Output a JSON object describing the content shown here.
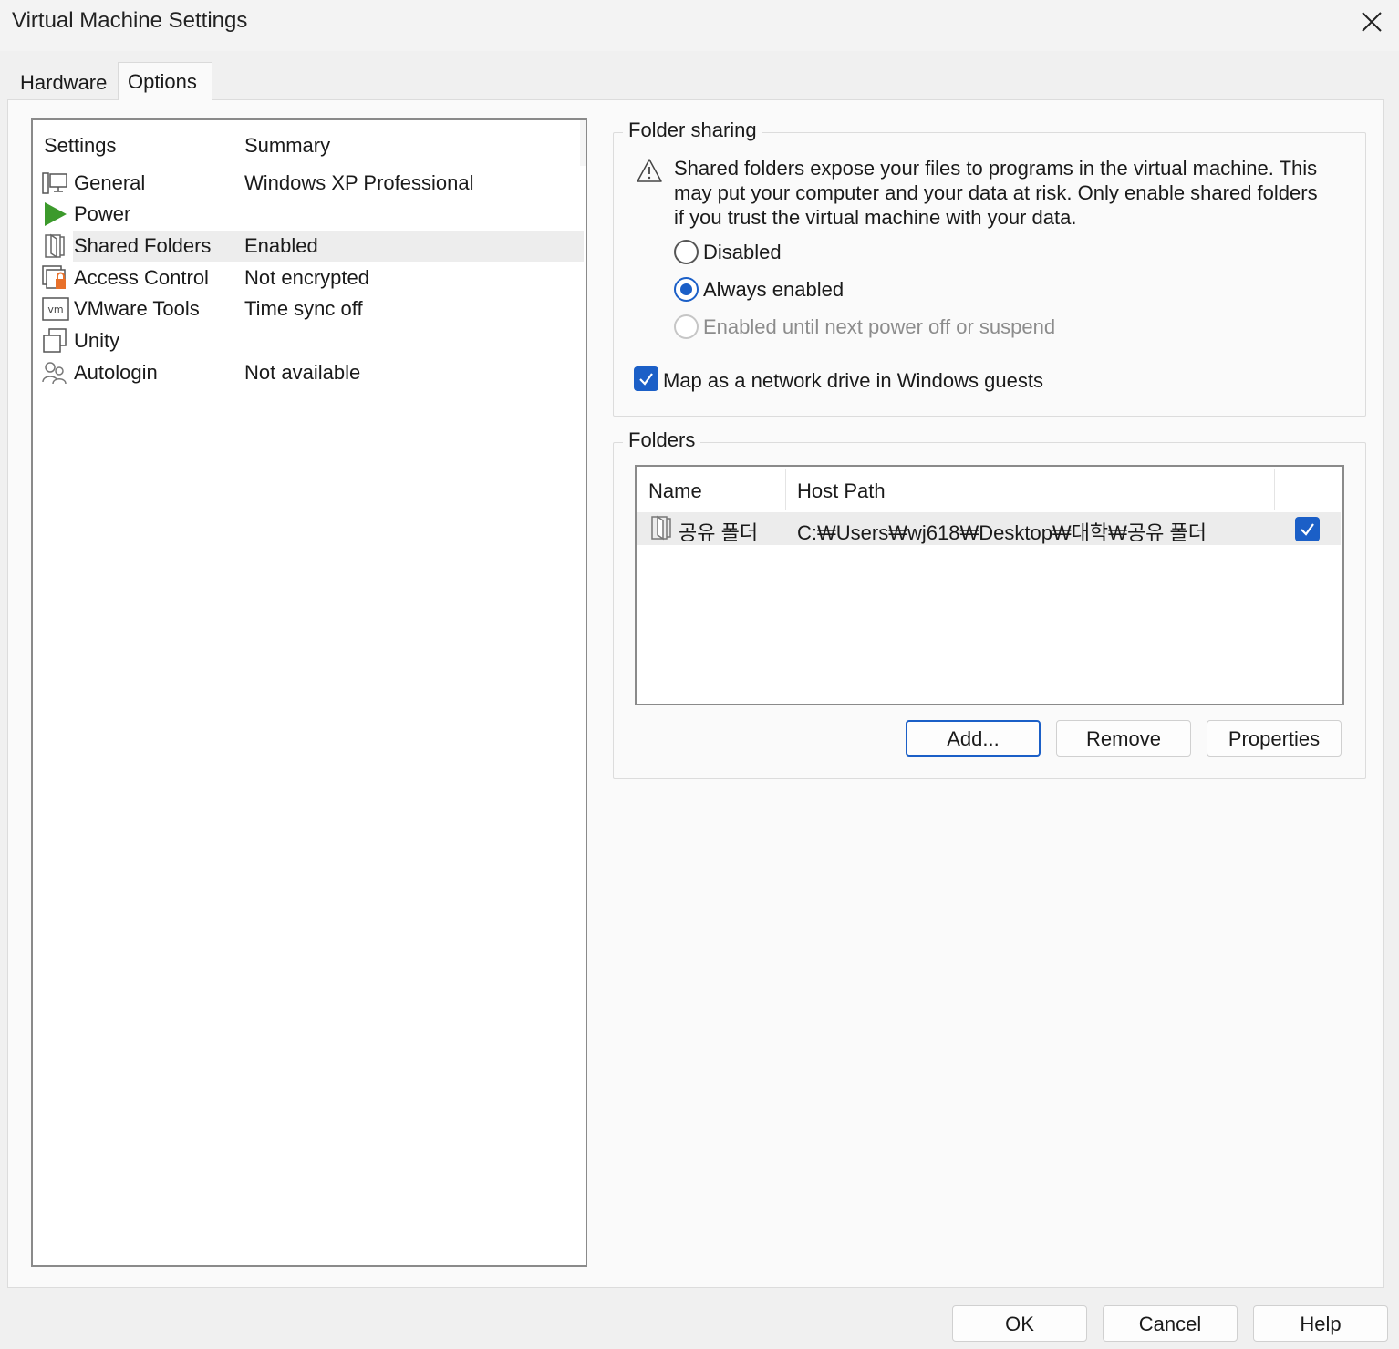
{
  "window": {
    "title": "Virtual Machine Settings"
  },
  "tabs": [
    {
      "label": "Hardware"
    },
    {
      "label": "Options"
    }
  ],
  "settings": {
    "header": {
      "settings": "Settings",
      "summary": "Summary"
    },
    "items": [
      {
        "name": "General",
        "summary": "Windows XP Professional",
        "icon": "monitor-icon"
      },
      {
        "name": "Power",
        "summary": "",
        "icon": "play-icon"
      },
      {
        "name": "Shared Folders",
        "summary": "Enabled",
        "icon": "shared-folder-icon"
      },
      {
        "name": "Access Control",
        "summary": "Not encrypted",
        "icon": "lock-icon"
      },
      {
        "name": "VMware Tools",
        "summary": "Time sync off",
        "icon": "vm-icon"
      },
      {
        "name": "Unity",
        "summary": "",
        "icon": "unity-windows-icon"
      },
      {
        "name": "Autologin",
        "summary": "Not available",
        "icon": "users-icon"
      }
    ]
  },
  "folder_sharing": {
    "label": "Folder sharing",
    "warning": "Shared folders expose your files to programs in the virtual machine. This may put your computer and your data at risk. Only enable shared folders if you trust the virtual machine with your data.",
    "options": [
      {
        "label": "Disabled",
        "checked": false,
        "disabled": false
      },
      {
        "label": "Always enabled",
        "checked": true,
        "disabled": false
      },
      {
        "label": "Enabled until next power off or suspend",
        "checked": false,
        "disabled": true
      }
    ],
    "map_drive": {
      "label": "Map as a network drive in Windows guests",
      "checked": true
    }
  },
  "folders": {
    "label": "Folders",
    "columns": {
      "name": "Name",
      "host_path": "Host Path"
    },
    "rows": [
      {
        "name": "공유 폴더",
        "host_path": "C:₩Users₩wj618₩Desktop₩대학₩공유 폴더",
        "enabled": true
      }
    ],
    "buttons": {
      "add": "Add...",
      "remove": "Remove",
      "properties": "Properties"
    }
  },
  "footer": {
    "ok": "OK",
    "cancel": "Cancel",
    "help": "Help"
  },
  "colors": {
    "accent": "#1b5fc7",
    "power_green": "#3c9a2c",
    "lock_orange": "#e8702a"
  }
}
